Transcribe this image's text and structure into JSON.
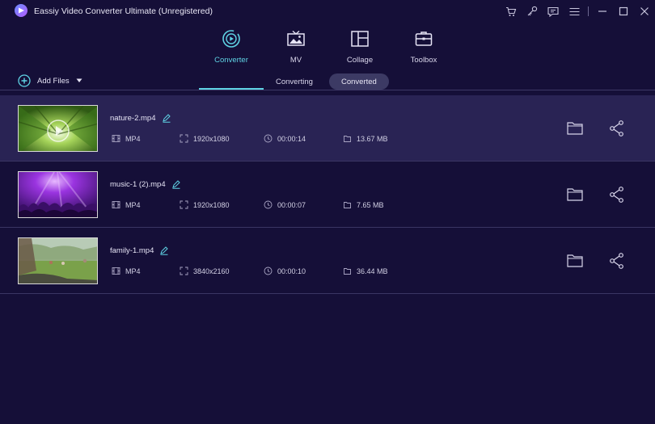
{
  "app": {
    "title": "Eassiy Video Converter Ultimate (Unregistered)",
    "brand_color": "#5fd3e4"
  },
  "window_controls": [
    "cart-icon",
    "key-icon",
    "feedback-icon",
    "menu-icon",
    "minimize-icon",
    "maximize-icon",
    "close-icon"
  ],
  "tabs": [
    {
      "label": "Converter",
      "icon": "converter-icon",
      "active": true
    },
    {
      "label": "MV",
      "icon": "mv-icon",
      "active": false
    },
    {
      "label": "Collage",
      "icon": "collage-icon",
      "active": false
    },
    {
      "label": "Toolbox",
      "icon": "toolbox-icon",
      "active": false
    }
  ],
  "toolbar": {
    "add_files_label": "Add Files",
    "segments": [
      {
        "label": "Converting",
        "active": false
      },
      {
        "label": "Converted",
        "active": true
      }
    ]
  },
  "files": [
    {
      "name": "nature-2.mp4",
      "format": "MP4",
      "resolution": "1920x1080",
      "duration": "00:00:14",
      "size": "13.67 MB",
      "selected": true
    },
    {
      "name": "music-1 (2).mp4",
      "format": "MP4",
      "resolution": "1920x1080",
      "duration": "00:00:07",
      "size": "7.65 MB",
      "selected": false
    },
    {
      "name": "family-1.mp4",
      "format": "MP4",
      "resolution": "3840x2160",
      "duration": "00:00:10",
      "size": "36.44 MB",
      "selected": false
    }
  ]
}
